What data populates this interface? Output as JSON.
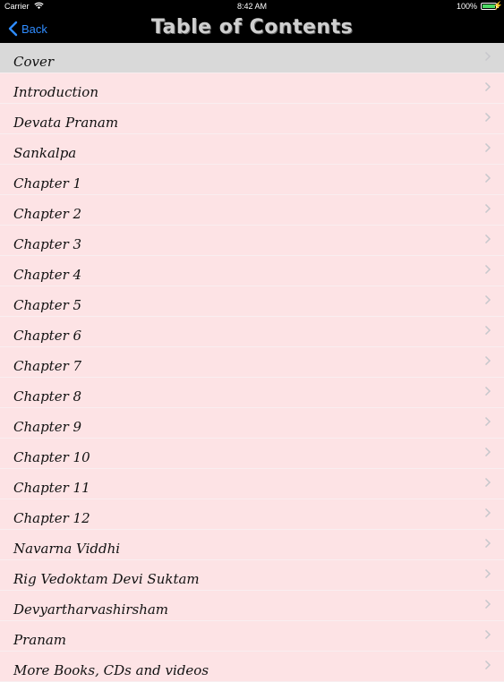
{
  "status": {
    "carrier": "Carrier",
    "time": "8:42 AM",
    "battery": "100%",
    "battery_level": 1.0,
    "wifi_icon": "wifi-icon",
    "battery_icon": "battery-icon"
  },
  "navbar": {
    "back_label": "Back",
    "title": "Table of Contents"
  },
  "colors": {
    "row_bg": "#fde3e5",
    "selected_bg": "#d9d9d9",
    "accent": "#2f8cff"
  },
  "toc": {
    "items": [
      {
        "label": "Cover",
        "selected": true
      },
      {
        "label": "Introduction"
      },
      {
        "label": "Devata Pranam"
      },
      {
        "label": "Sankalpa"
      },
      {
        "label": "Chapter 1"
      },
      {
        "label": "Chapter 2"
      },
      {
        "label": "Chapter 3"
      },
      {
        "label": "Chapter 4"
      },
      {
        "label": "Chapter 5"
      },
      {
        "label": "Chapter 6"
      },
      {
        "label": "Chapter 7"
      },
      {
        "label": "Chapter 8"
      },
      {
        "label": "Chapter 9"
      },
      {
        "label": "Chapter 10"
      },
      {
        "label": "Chapter 11"
      },
      {
        "label": "Chapter 12"
      },
      {
        "label": "Navarna Viddhi"
      },
      {
        "label": "Rig Vedoktam Devi Suktam"
      },
      {
        "label": "Devyartharvashirsham"
      },
      {
        "label": "Pranam"
      },
      {
        "label": "More Books, CDs and videos"
      }
    ]
  }
}
